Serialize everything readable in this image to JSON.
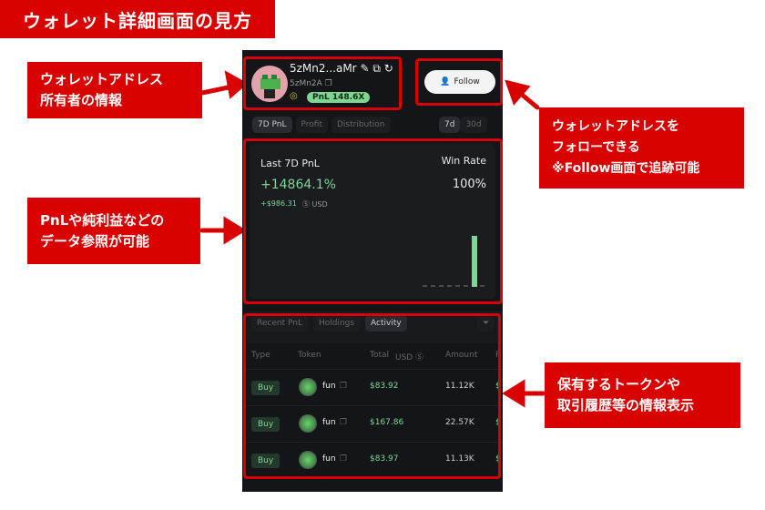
{
  "title": "ウォレット詳細画面の見方",
  "notes": {
    "owner": [
      "ウォレットアドレス",
      "所有者の情報"
    ],
    "pnl": [
      "PnLや純利益などの",
      "データ参照が可能"
    ],
    "follow": [
      "ウォレットアドレスを",
      "フォローできる",
      "※Follow画面で追跡可能"
    ],
    "holdings": [
      "保有するトークンや",
      "取引履歴等の情報表示"
    ]
  },
  "wallet": {
    "name": "5zMn2...aMr",
    "short": "5zMn2A",
    "pnl_badge": "PnL 148.6X",
    "follow_label": "Follow"
  },
  "tabs": [
    "7D PnL",
    "Profit",
    "Distribution"
  ],
  "range_tabs": [
    "7d",
    "30d"
  ],
  "card": {
    "label": "Last 7D PnL",
    "pnl_pct": "+14864.1%",
    "pnl_usd": "+$986.31",
    "currency": "USD",
    "winrate_label": "Win Rate",
    "winrate": "100%"
  },
  "chart_data": {
    "type": "bar",
    "values": [
      0,
      0,
      0,
      0,
      0,
      0,
      1,
      0
    ],
    "color": "#7fd693"
  },
  "list_tabs": [
    "Recent PnL",
    "Holdings",
    "Activity"
  ],
  "table": {
    "headers": [
      "Type",
      "Token",
      "Total",
      "USD",
      "Amount",
      "P"
    ],
    "rows": [
      {
        "type": "Buy",
        "token": "fun",
        "total": "$83.92",
        "amount": "11.12K",
        "price": "$"
      },
      {
        "type": "Buy",
        "token": "fun",
        "total": "$167.86",
        "amount": "22.57K",
        "price": "$"
      },
      {
        "type": "Buy",
        "token": "fun",
        "total": "$83.97",
        "amount": "11.13K",
        "price": "$"
      }
    ]
  },
  "colors": {
    "accent": "#d90000",
    "positive": "#7fd693"
  }
}
